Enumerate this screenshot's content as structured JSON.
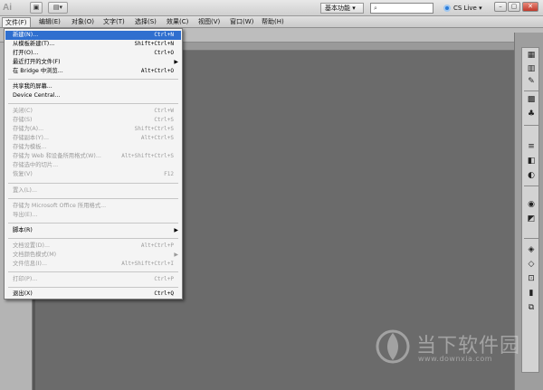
{
  "app": {
    "logo_text": "Ai",
    "workspace_label": "基本功能 ▾",
    "cs_live_label": "CS Live ▾",
    "win_min": "–",
    "win_max": "▢",
    "win_close": "✕"
  },
  "menubar": {
    "items": [
      {
        "label": "文件(F)"
      },
      {
        "label": "编辑(E)"
      },
      {
        "label": "对象(O)"
      },
      {
        "label": "文字(T)"
      },
      {
        "label": "选择(S)"
      },
      {
        "label": "效果(C)"
      },
      {
        "label": "视图(V)"
      },
      {
        "label": "窗口(W)"
      },
      {
        "label": "帮助(H)"
      }
    ]
  },
  "file_menu": {
    "items": [
      {
        "label": "新建(N)...",
        "shortcut": "Ctrl+N",
        "state": "highlight"
      },
      {
        "label": "从模板新建(T)...",
        "shortcut": "Shift+Ctrl+N",
        "state": "enabled"
      },
      {
        "label": "打开(O)...",
        "shortcut": "Ctrl+O",
        "state": "enabled"
      },
      {
        "label": "最近打开的文件(F)",
        "shortcut": "",
        "state": "enabled",
        "submenu": true
      },
      {
        "label": "在 Bridge 中浏览...",
        "shortcut": "Alt+Ctrl+O",
        "state": "enabled"
      },
      {
        "label": "共享我的屏幕...",
        "shortcut": "",
        "state": "enabled"
      },
      {
        "label": "Device Central...",
        "shortcut": "",
        "state": "enabled"
      },
      {
        "label": "关闭(C)",
        "shortcut": "Ctrl+W",
        "state": "disabled"
      },
      {
        "label": "存储(S)",
        "shortcut": "Ctrl+S",
        "state": "disabled"
      },
      {
        "label": "存储为(A)...",
        "shortcut": "Shift+Ctrl+S",
        "state": "disabled"
      },
      {
        "label": "存储副本(Y)...",
        "shortcut": "Alt+Ctrl+S",
        "state": "disabled"
      },
      {
        "label": "存储为模板...",
        "shortcut": "",
        "state": "disabled"
      },
      {
        "label": "存储为 Web 和设备所用格式(W)...",
        "shortcut": "Alt+Shift+Ctrl+S",
        "state": "disabled"
      },
      {
        "label": "存储选中的切片...",
        "shortcut": "",
        "state": "disabled"
      },
      {
        "label": "恢复(V)",
        "shortcut": "F12",
        "state": "disabled"
      },
      {
        "label": "置入(L)...",
        "shortcut": "",
        "state": "disabled"
      },
      {
        "label": "存储为 Microsoft Office 所用格式...",
        "shortcut": "",
        "state": "disabled"
      },
      {
        "label": "导出(E)...",
        "shortcut": "",
        "state": "disabled"
      },
      {
        "label": "脚本(R)",
        "shortcut": "",
        "state": "enabled",
        "submenu": true
      },
      {
        "label": "文档设置(D)...",
        "shortcut": "Alt+Ctrl+P",
        "state": "disabled"
      },
      {
        "label": "文档颜色模式(M)",
        "shortcut": "",
        "state": "disabled",
        "submenu": true
      },
      {
        "label": "文件信息(I)...",
        "shortcut": "Alt+Shift+Ctrl+I",
        "state": "disabled"
      },
      {
        "label": "打印(P)...",
        "shortcut": "Ctrl+P",
        "state": "disabled"
      },
      {
        "label": "退出(X)",
        "shortcut": "Ctrl+Q",
        "state": "enabled"
      }
    ]
  },
  "watermark": {
    "text": "当下软件园",
    "url": "www.downxia.com"
  },
  "colors": {
    "highlight": "#2f6fcf",
    "workspace_bg": "#6b6b6b",
    "menu_bg": "#f4f4f4"
  },
  "icons": {
    "search": "search-icon",
    "cs_live": "cs-live-icon"
  }
}
